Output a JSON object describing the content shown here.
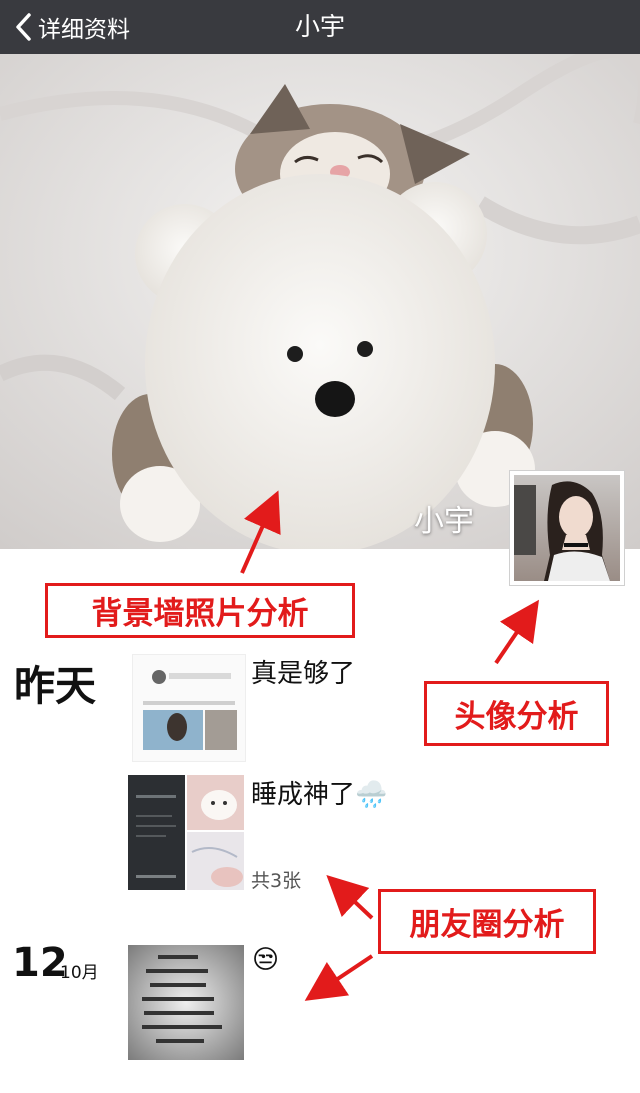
{
  "nav": {
    "back_label": "详细资料",
    "title": "小宇"
  },
  "cover": {
    "name": "小宇"
  },
  "annotations": {
    "cover": "背景墙照片分析",
    "avatar": "头像分析",
    "moments": "朋友圈分析"
  },
  "moments": [
    {
      "date": "昨天",
      "text": "真是够了",
      "thumb_caption_top": "@改变你的爱情故事",
      "thumb_caption_line": "\"朋友圈能介于\"不想理我\"和\"说了算情\"之间...\""
    },
    {
      "text": "睡成神了🌧️",
      "count": "共3张"
    },
    {
      "day": "12",
      "month": "10月",
      "text": "😒",
      "handwriting": [
        "降温了",
        "我喜欢的人",
        "喜欢我的人",
        "记得添加衣服",
        "不喜欢我的人",
        "就不要穿衣服了",
        "冻死那些"
      ]
    }
  ],
  "colors": {
    "nav": "#393a3f",
    "annotation": "#e21b1b"
  }
}
